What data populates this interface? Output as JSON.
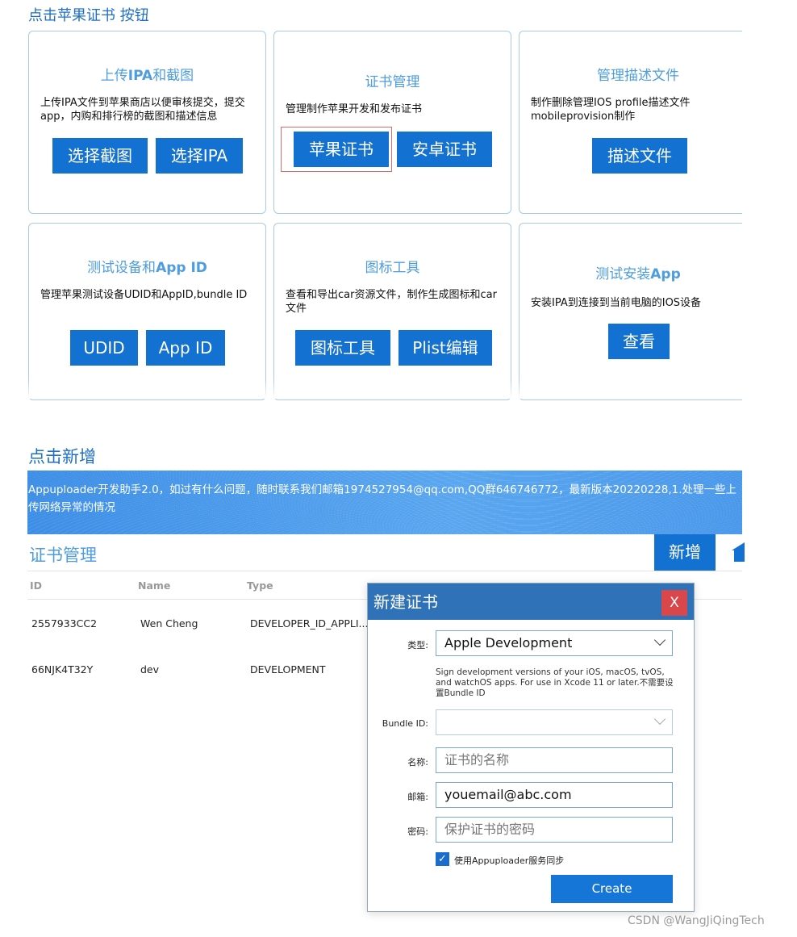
{
  "headings": {
    "step1": "点击苹果证书 按钮",
    "step2": "点击新增"
  },
  "cards": [
    {
      "title_pre": "上传",
      "title_bold": "IPA",
      "title_post": "和截图",
      "desc": "上传IPA文件到苹果商店以便审核提交，提交app，内购和排行榜的截图和描述信息",
      "buttons": [
        "选择截图",
        "选择IPA"
      ]
    },
    {
      "title_pre": "证书管理",
      "title_bold": "",
      "title_post": "",
      "desc": "管理制作苹果开发和发布证书",
      "buttons": [
        "苹果证书",
        "安卓证书"
      ]
    },
    {
      "title_pre": "管理描述文件",
      "title_bold": "",
      "title_post": "",
      "desc": "制作删除管理IOS profile描述文件mobileprovision制作",
      "buttons": [
        "描述文件"
      ]
    },
    {
      "title_pre": "测试设备和",
      "title_bold": "App ID",
      "title_post": "",
      "desc": "管理苹果测试设备UDID和AppID,bundle ID",
      "buttons": [
        "UDID",
        "App ID"
      ]
    },
    {
      "title_pre": "图标工具",
      "title_bold": "",
      "title_post": "",
      "desc": "查看和导出car资源文件，制作生成图标和car文件",
      "buttons": [
        "图标工具",
        "Plist编辑"
      ]
    },
    {
      "title_pre": "测试安装",
      "title_bold": "App",
      "title_post": "",
      "desc": "安装IPA到连接到当前电脑的IOS设备",
      "buttons": [
        "查看"
      ]
    }
  ],
  "banner": {
    "text": "Appuploader开发助手2.0，如过有什么问题，随时联系我们邮箱1974527954@qq.com,QQ群646746772，最新版本20220228,1.处理一些上传网络异常的情况"
  },
  "cert_panel": {
    "title": "证书管理",
    "add_label": "新增",
    "columns": [
      "ID",
      "Name",
      "Type"
    ],
    "rows": [
      {
        "id": "2557933CC2",
        "name": "Wen Cheng",
        "type": "DEVELOPER_ID_APPLI..."
      },
      {
        "id": "66NJK4T32Y",
        "name": "dev",
        "type": "DEVELOPMENT"
      }
    ]
  },
  "dialog": {
    "title": "新建证书",
    "close_label": "X",
    "type_label": "类型:",
    "type_value": "Apple Development",
    "help_text": "Sign development versions of your iOS, macOS, tvOS, and watchOS apps. For use in Xcode 11 or later.不需要设置Bundle ID",
    "bundle_label": "Bundle ID:",
    "bundle_value": "",
    "name_label": "名称:",
    "name_placeholder": "证书的名称",
    "email_label": "邮箱:",
    "email_value": "youemail@abc.com",
    "password_label": "密码:",
    "password_placeholder": "保护证书的密码",
    "sync_checked": true,
    "sync_label": "使用Appuploader服务同步",
    "create_label": "Create"
  },
  "watermark": "CSDN @WangJiQingTech",
  "colors": {
    "accent": "#1371d1",
    "title_blue": "#4d9ddf",
    "dialog_header": "#2f72b8",
    "close_red": "#d9474a"
  }
}
